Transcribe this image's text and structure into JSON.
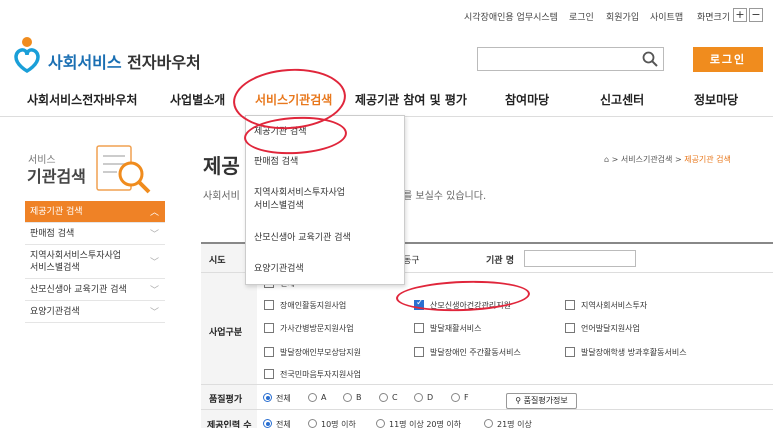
{
  "util": {
    "blind": "시각장애인용 업무시스템",
    "login": "로그인",
    "join": "회원가입",
    "sitemap": "사이트맵",
    "font_size": "화면크기",
    "plus": "+",
    "minus": "−"
  },
  "logo": {
    "blue": "사회서비스",
    "dark": " 전자바우처"
  },
  "header": {
    "login_button": "로그인"
  },
  "gnb": [
    "사회서비스전자바우처",
    "사업별소개",
    "서비스기관검색",
    "제공기관 참여 및 평가",
    "참여마당",
    "신고센터",
    "정보마당"
  ],
  "sidebar": {
    "title_small": "서비스",
    "title": "기관검색",
    "items": [
      "제공기관 검색",
      "판매점 검색",
      "지역사회서비스투자사업\n서비스별검색",
      "산모신생아 교육기관 검색",
      "요양기관검색"
    ]
  },
  "page": {
    "heading": "제공",
    "desc_left": "사회서비",
    "desc_right": "를 보실수 있습니다."
  },
  "breadcrumb": {
    "sep": ">",
    "parent": "서비스기관검색",
    "current": "제공기관 검색"
  },
  "dropdown": [
    "제공기관 검색",
    "판매점 검색",
    "지역사회서비스투자사업",
    "서비스별검색",
    "산모신생아 교육기관 검색",
    "요양기관검색"
  ],
  "form": {
    "sido_label": "시도",
    "sido_partial": "동구",
    "org_name_label": "기관 명",
    "biz_label": "사업구분",
    "all_partial": "전체",
    "checkboxes": [
      "장애인활동지원사업",
      "산모신생아건강관리지원",
      "지역사회서비스투자",
      "가사간병방문지원사업",
      "발달재활서비스",
      "언어발달지원사업",
      "발달장애인부모상담지원",
      "발달장애인 주간활동서비스",
      "발달장애학생 방과후활동서비스",
      "전국민마음투자지원사업"
    ],
    "quality_label": "품질평가",
    "quality_options": [
      "전체",
      "A",
      "B",
      "C",
      "D",
      "F"
    ],
    "quality_button": "품질평가정보",
    "staff_label": "제공인력 수",
    "staff_options": [
      "전체",
      "10명 이하",
      "11명 이상 20명 이하",
      "21명 이상"
    ]
  },
  "colors": {
    "accent": "#f08c1e",
    "brand_blue": "#1a6fb3",
    "annotation": "#e0263b",
    "check": "#2a6fd1"
  }
}
